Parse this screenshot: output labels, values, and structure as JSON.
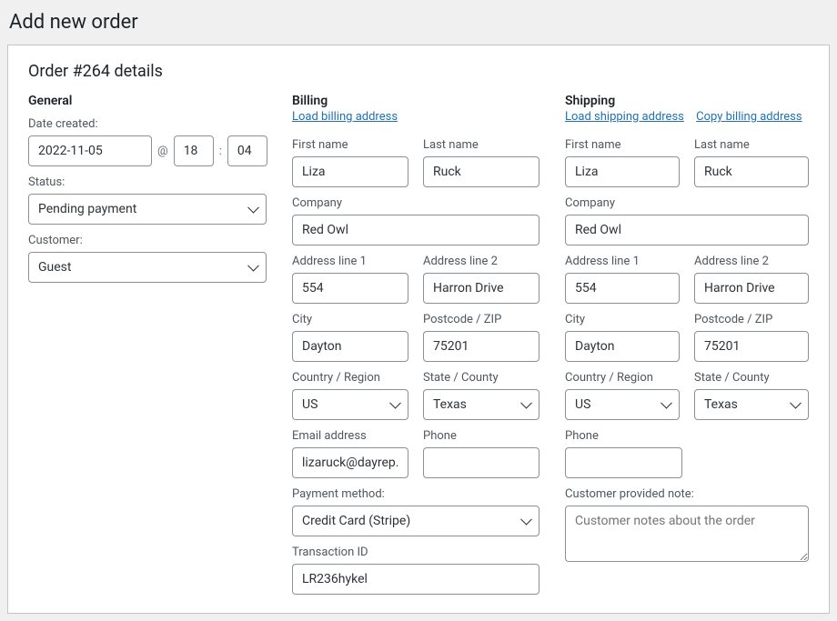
{
  "page": {
    "title": "Add new order",
    "panel_title": "Order #264 details"
  },
  "general": {
    "title": "General",
    "date_label": "Date created:",
    "date": "2022-11-05",
    "at": "@",
    "hour": "18",
    "colon": ":",
    "minute": "04",
    "status_label": "Status:",
    "status": "Pending payment",
    "customer_label": "Customer:",
    "customer": "Guest"
  },
  "billing": {
    "title": "Billing",
    "load_link": "Load billing address",
    "first_name_label": "First name",
    "first_name": "Liza",
    "last_name_label": "Last name",
    "last_name": "Ruck",
    "company_label": "Company",
    "company": "Red Owl",
    "addr1_label": "Address line 1",
    "addr1": "554",
    "addr2_label": "Address line 2",
    "addr2": "Harron Drive",
    "city_label": "City",
    "city": "Dayton",
    "postcode_label": "Postcode / ZIP",
    "postcode": "75201",
    "country_label": "Country / Region",
    "country": "US",
    "state_label": "State / County",
    "state": "Texas",
    "email_label": "Email address",
    "email": "lizaruck@dayrep.c",
    "phone_label": "Phone",
    "phone": "",
    "payment_label": "Payment method:",
    "payment": "Credit Card (Stripe)",
    "txn_label": "Transaction ID",
    "txn": "LR236hykel"
  },
  "shipping": {
    "title": "Shipping",
    "load_link": "Load shipping address",
    "copy_link": "Copy billing address",
    "first_name_label": "First name",
    "first_name": "Liza",
    "last_name_label": "Last name",
    "last_name": "Ruck",
    "company_label": "Company",
    "company": "Red Owl",
    "addr1_label": "Address line 1",
    "addr1": "554",
    "addr2_label": "Address line 2",
    "addr2": "Harron Drive",
    "city_label": "City",
    "city": "Dayton",
    "postcode_label": "Postcode / ZIP",
    "postcode": "75201",
    "country_label": "Country / Region",
    "country": "US",
    "state_label": "State / County",
    "state": "Texas",
    "phone_label": "Phone",
    "phone": "",
    "note_label": "Customer provided note:",
    "note_placeholder": "Customer notes about the order"
  }
}
